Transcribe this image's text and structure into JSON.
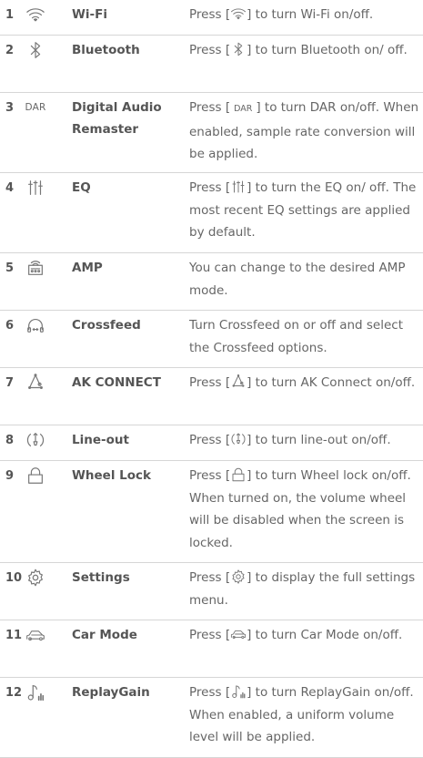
{
  "rows": [
    {
      "num": "1",
      "icon": "wifi-icon",
      "name": "Wi-Fi",
      "desc_pre": "Press [",
      "desc_post": "] to turn Wi-Fi on/off.",
      "h": 39
    },
    {
      "num": "2",
      "icon": "bluetooth-icon",
      "name": "Bluetooth",
      "desc_pre": "Press [",
      "desc_post": "] to turn Bluetooth on/ off.",
      "h": 63
    },
    {
      "num": "3",
      "icon_text": "DAR",
      "icon": "dar-icon",
      "name": "Digital Audio Remaster",
      "desc_pre": "Press [",
      "desc_inline_text": "DAR",
      "desc_post": "] to turn DAR on/off. When enabled, sample rate conversion will be applied.",
      "h": 88
    },
    {
      "num": "4",
      "icon": "eq-icon",
      "name": "EQ",
      "desc_pre": "Press [",
      "desc_post": "] to turn the EQ on/ off. The most recent EQ settings are applied by default.",
      "h": 88
    },
    {
      "num": "5",
      "icon": "amp-icon",
      "name": "AMP",
      "desc_pre": "",
      "desc_post": "You can change to the desired AMP mode.",
      "h": 63
    },
    {
      "num": "6",
      "icon": "headphone-icon",
      "name": "Crossfeed",
      "desc_pre": "",
      "desc_post": "Turn Crossfeed on or off and select the Crossfeed options.",
      "h": 63
    },
    {
      "num": "7",
      "icon": "ak-connect-icon",
      "name": "AK CONNECT",
      "desc_pre": "Press [",
      "desc_post": "] to turn AK Connect on/off.",
      "h": 63
    },
    {
      "num": "8",
      "icon": "line-out-icon",
      "name": "Line-out",
      "desc_pre": "Press [",
      "desc_post": "] to turn line-out on/off.",
      "h": 39
    },
    {
      "num": "9",
      "icon": "lock-icon",
      "name": "Wheel Lock",
      "desc_pre": "Press [",
      "desc_post": "] to turn Wheel lock on/off. When turned on, the volume wheel will be disabled when the screen is locked.",
      "h": 112
    },
    {
      "num": "10",
      "icon": "settings-icon",
      "name": "Settings",
      "desc_pre": "Press [",
      "desc_post": "] to display the full settings menu.",
      "h": 63
    },
    {
      "num": "11",
      "icon": "car-icon",
      "name": "Car Mode",
      "desc_pre": "Press [",
      "desc_post": "] to turn Car Mode on/off.",
      "h": 63
    },
    {
      "num": "12",
      "icon": "replaygain-icon",
      "name": "ReplayGain",
      "desc_pre": "Press [",
      "desc_post": "] to turn ReplayGain on/off. When enabled, a uniform volume level will be applied.",
      "h": 88
    }
  ]
}
